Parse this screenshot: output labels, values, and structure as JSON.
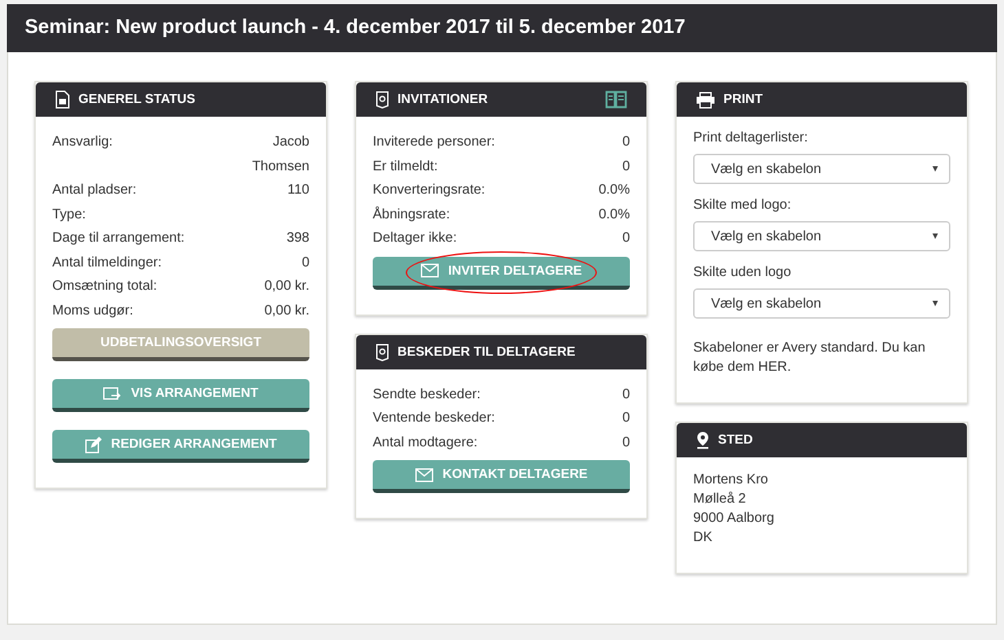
{
  "page_title": "Seminar: New product launch - 4. december 2017 til 5. december 2017",
  "columns": [
    {
      "panels": [
        {
          "title": "GENEREL STATUS",
          "header_action": false,
          "rows": [
            {
              "label": "Ansvarlig:",
              "value": "Jacob Thomsen"
            },
            {
              "label": "Antal pladser:",
              "value": "110"
            },
            {
              "label": "Type:"
            },
            {
              "label": "Dage til arrangement:",
              "value": "398"
            },
            {
              "label": "Antal tilmeldinger:",
              "value": "0"
            },
            {
              "label": "Omsætning total:",
              "value": "0,00 kr."
            },
            {
              "label": "Moms udgør:",
              "value": "0,00 kr."
            }
          ],
          "buttons": [
            {
              "label": "UDBETALINGSOVERSIGT",
              "disabled": true,
              "highlighted": false
            },
            {
              "label": "VIS ARRANGEMENT",
              "disabled": false,
              "highlighted": false
            },
            {
              "label": "REDIGER ARRANGEMENT",
              "disabled": false,
              "highlighted": false
            }
          ]
        }
      ]
    },
    {
      "panels": [
        {
          "title": "INVITATIONER",
          "header_action": true,
          "rows": [
            {
              "label": "Inviterede personer:",
              "value": "0"
            },
            {
              "label": "Er tilmeldt:",
              "value": "0"
            },
            {
              "label": "Konverteringsrate:",
              "value": "0.0%"
            },
            {
              "label": "Åbningsrate:",
              "value": "0.0%"
            },
            {
              "label": "Deltager ikke:",
              "value": "0"
            }
          ],
          "buttons": [
            {
              "label": "INVITER DELTAGERE",
              "disabled": false,
              "highlighted": true
            }
          ]
        },
        {
          "title": "BESKEDER TIL DELTAGERE",
          "header_action": false,
          "rows": [
            {
              "label": "Sendte beskeder:",
              "value": "0"
            },
            {
              "label": "Ventende beskeder:",
              "value": "0"
            },
            {
              "label": "Antal modtagere:",
              "value": "0"
            }
          ],
          "buttons": [
            {
              "label": "KONTAKT DELTAGERE",
              "disabled": false,
              "highlighted": false
            }
          ]
        }
      ]
    },
    {
      "panels": [
        {
          "title": "PRINT",
          "header_action": false,
          "selects": [
            {
              "label": "Print deltagerlister:",
              "value": "Vælg en skabelon"
            },
            {
              "label": "Skilte med logo:",
              "value": "Vælg en skabelon"
            },
            {
              "label": "Skilte uden logo",
              "value": "Vælg en skabelon"
            }
          ],
          "note": "Skabeloner er Avery standard. Du kan købe dem HER."
        },
        {
          "title": "STED",
          "header_action": false,
          "address": [
            "Mortens Kro",
            "Mølleå 2",
            "9000 Aalborg",
            "DK"
          ]
        }
      ]
    }
  ]
}
